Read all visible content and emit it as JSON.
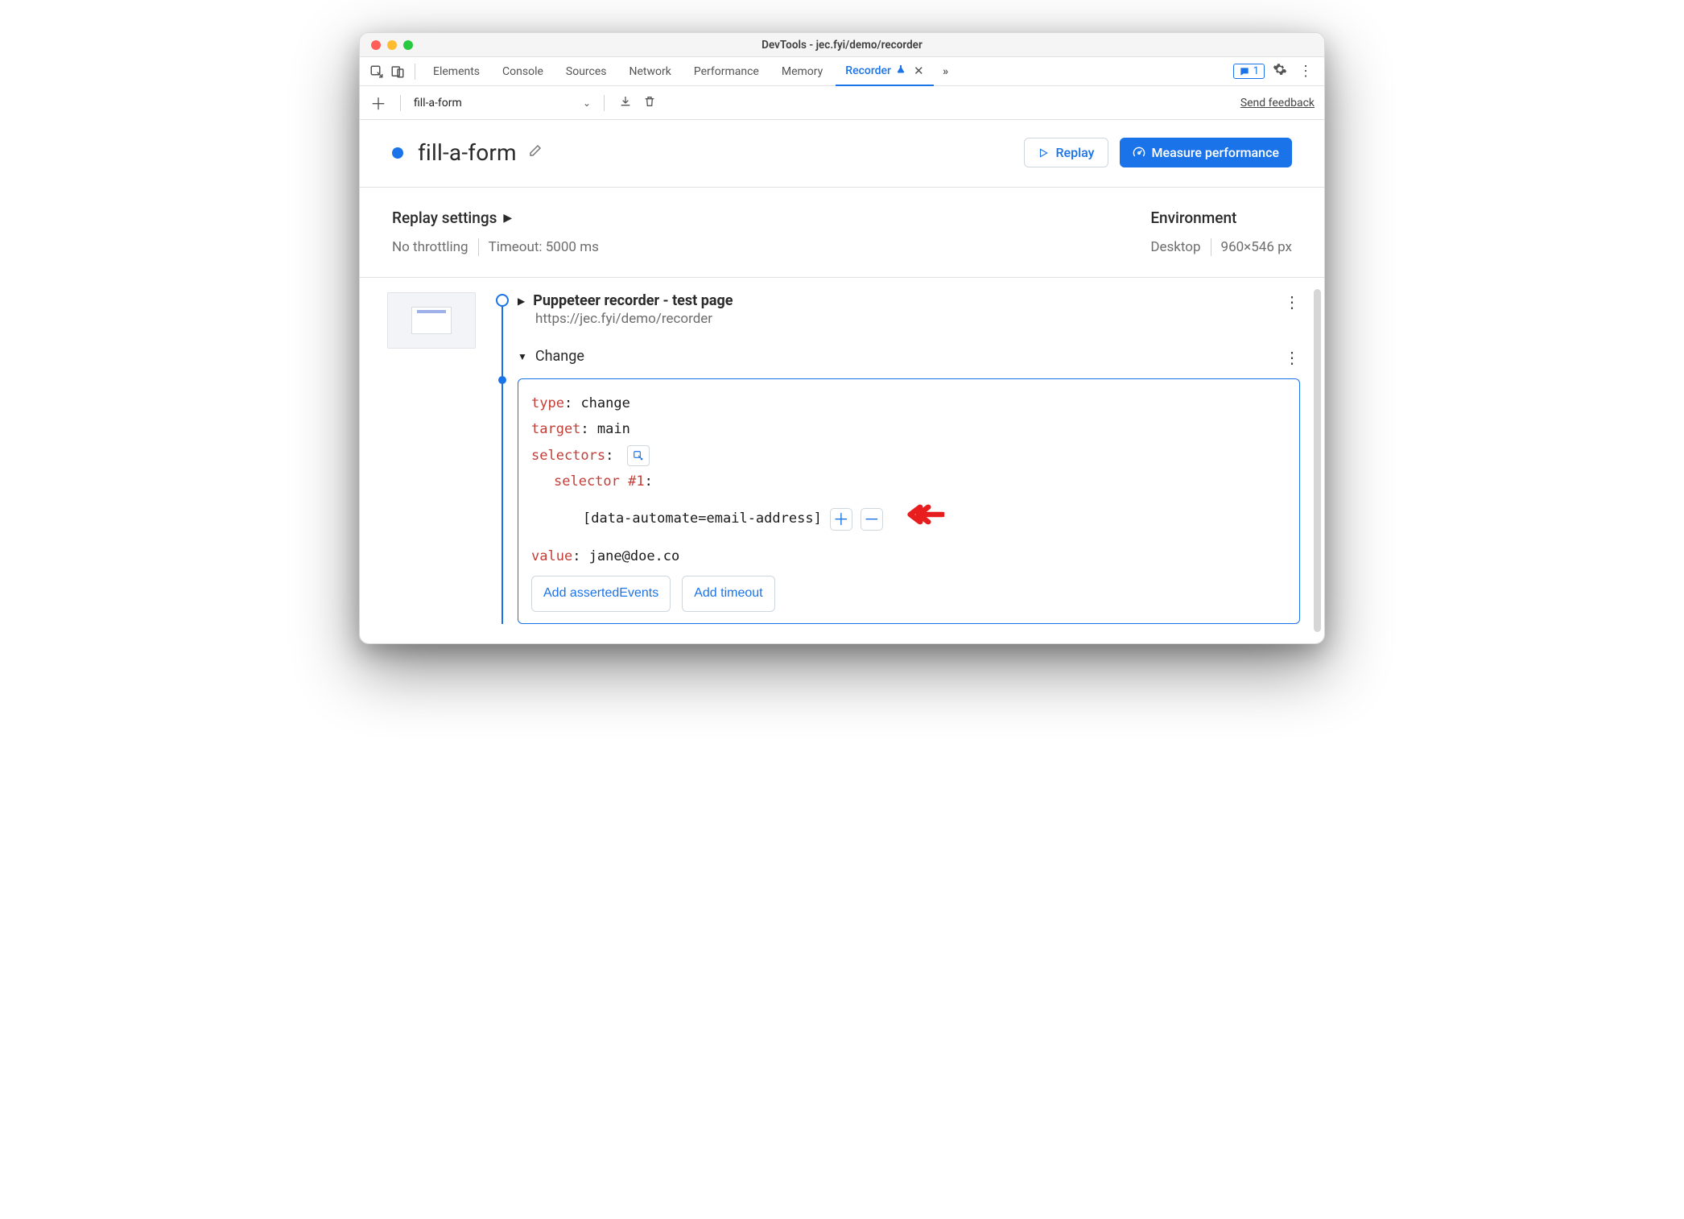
{
  "window": {
    "title": "DevTools - jec.fyi/demo/recorder"
  },
  "tabs": {
    "items": [
      "Elements",
      "Console",
      "Sources",
      "Network",
      "Performance",
      "Memory"
    ],
    "active": "Recorder",
    "msg_count": "1"
  },
  "toolbar": {
    "recording_name": "fill-a-form",
    "feedback": "Send feedback"
  },
  "header": {
    "title": "fill-a-form",
    "replay": "Replay",
    "measure": "Measure performance"
  },
  "settings": {
    "replay_heading": "Replay settings",
    "throttling": "No throttling",
    "timeout": "Timeout: 5000 ms",
    "env_heading": "Environment",
    "env_device": "Desktop",
    "env_dims": "960×546 px"
  },
  "steps": {
    "start": {
      "title": "Puppeteer recorder - test page",
      "url": "https://jec.fyi/demo/recorder"
    },
    "change": {
      "label": "Change",
      "type_k": "type",
      "type_v": "change",
      "target_k": "target",
      "target_v": "main",
      "selectors_k": "selectors",
      "sel1_k": "selector #1",
      "sel1_v": "[data-automate=email-address]",
      "value_k": "value",
      "value_v": "jane@doe.co",
      "add_asserted": "Add assertedEvents",
      "add_timeout": "Add timeout"
    }
  }
}
